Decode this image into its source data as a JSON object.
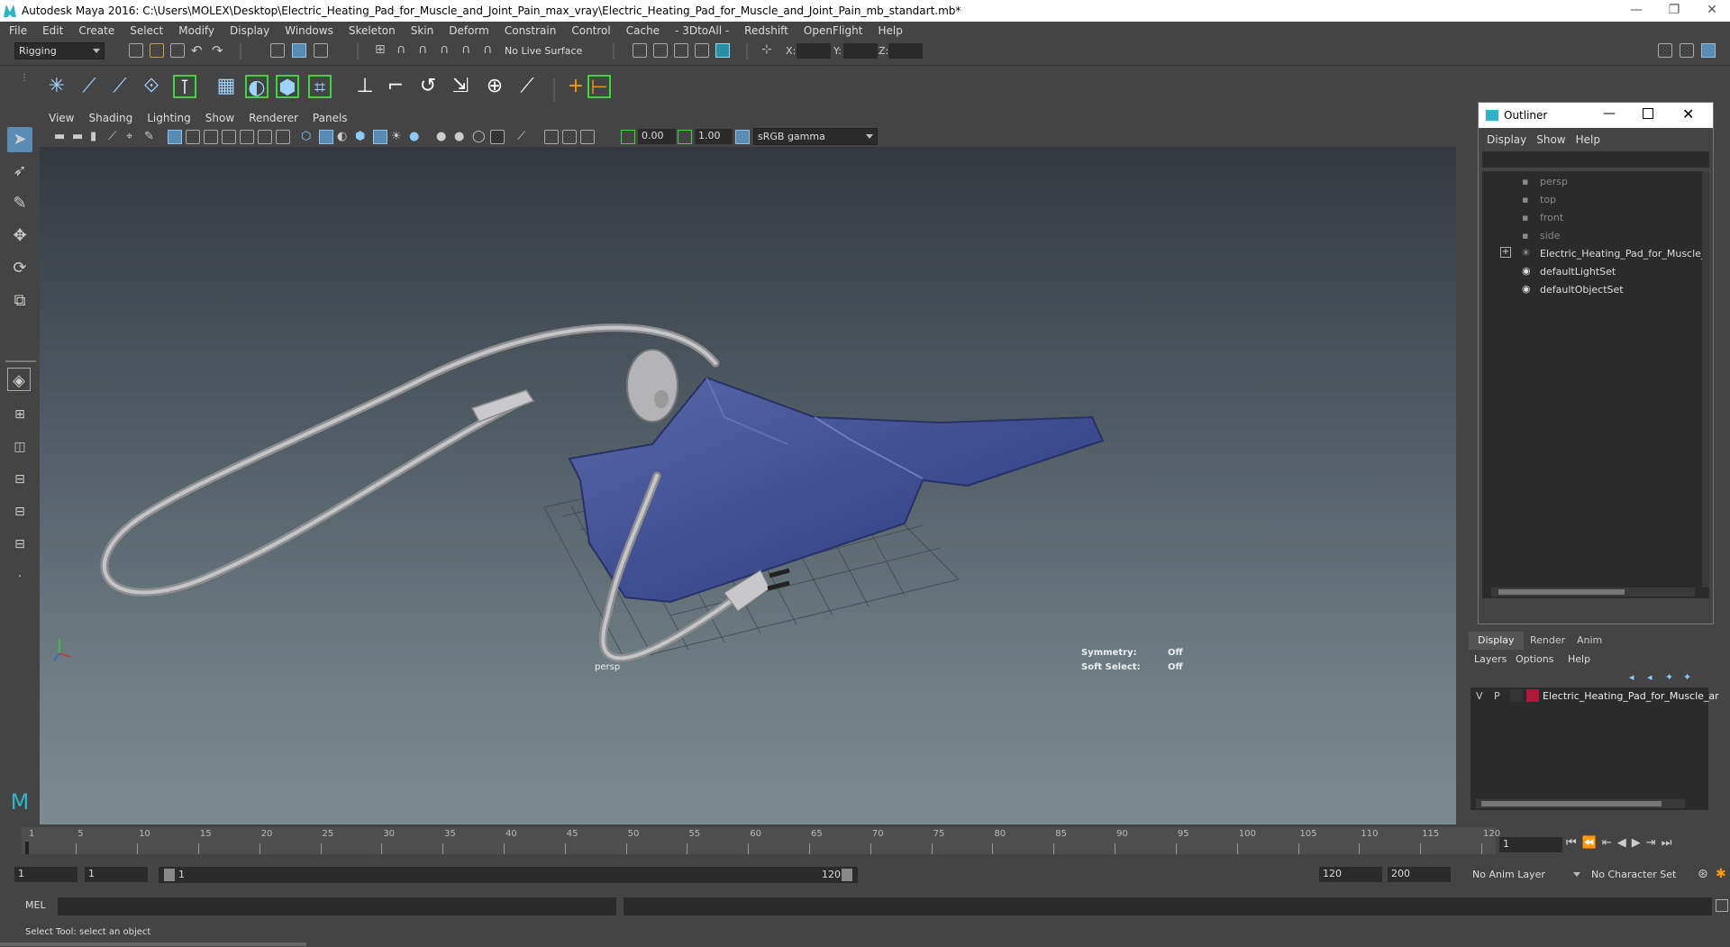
{
  "window": {
    "title": "Autodesk Maya 2016: C:\\Users\\MOLEX\\Desktop\\Electric_Heating_Pad_for_Muscle_and_Joint_Pain_max_vray\\Electric_Heating_Pad_for_Muscle_and_Joint_Pain_mb_standart.mb*",
    "minimize": "—",
    "restore": "❐",
    "close": "✕"
  },
  "menubar": [
    "File",
    "Edit",
    "Create",
    "Select",
    "Modify",
    "Display",
    "Windows",
    "Skeleton",
    "Skin",
    "Deform",
    "Constrain",
    "Control",
    "Cache",
    "- 3DtoAll -",
    "Redshift",
    "OpenFlight",
    "Help"
  ],
  "toolbar": {
    "menuset": "Rigging",
    "live_surface": "No Live Surface",
    "x_label": "X:",
    "y_label": "Y:",
    "z_label": "Z:"
  },
  "viewport": {
    "menu": [
      "View",
      "Shading",
      "Lighting",
      "Show",
      "Renderer",
      "Panels"
    ],
    "exposure": "0.00",
    "gamma": "1.00",
    "colorspace": "sRGB gamma",
    "camera_label": "persp",
    "symmetry_label": "Symmetry:",
    "symmetry_value": "Off",
    "softselect_label": "Soft Select:",
    "softselect_value": "Off"
  },
  "outliner": {
    "title": "Outliner",
    "menu": [
      "Display",
      "Show",
      "Help"
    ],
    "items": [
      {
        "label": "persp",
        "type": "camera"
      },
      {
        "label": "top",
        "type": "camera"
      },
      {
        "label": "front",
        "type": "camera"
      },
      {
        "label": "side",
        "type": "camera"
      },
      {
        "label": "Electric_Heating_Pad_for_Muscle_a",
        "type": "group"
      },
      {
        "label": "defaultLightSet",
        "type": "set"
      },
      {
        "label": "defaultObjectSet",
        "type": "set"
      }
    ]
  },
  "layers": {
    "tabs": [
      "Display",
      "Render",
      "Anim"
    ],
    "menu": [
      "Layers",
      "Options",
      "Help"
    ],
    "layer_v": "V",
    "layer_p": "P",
    "layer_name": "Electric_Heating_Pad_for_Muscle_ar",
    "layer_color": "#b0163a"
  },
  "timeline": {
    "ticks": [
      "1",
      "5",
      "10",
      "15",
      "20",
      "25",
      "30",
      "35",
      "40",
      "45",
      "50",
      "55",
      "60",
      "65",
      "70",
      "75",
      "80",
      "85",
      "90",
      "95",
      "100",
      "105",
      "110",
      "115",
      "120"
    ],
    "current_frame": "1"
  },
  "range": {
    "start": "1",
    "playback_start": "1",
    "slider_start": "1",
    "slider_end": "120",
    "playback_end": "120",
    "end": "200",
    "anim_layer": "No Anim Layer",
    "character_set": "No Character Set"
  },
  "command": {
    "mel_label": "MEL"
  },
  "status": {
    "help_line": "Select Tool: select an object"
  }
}
